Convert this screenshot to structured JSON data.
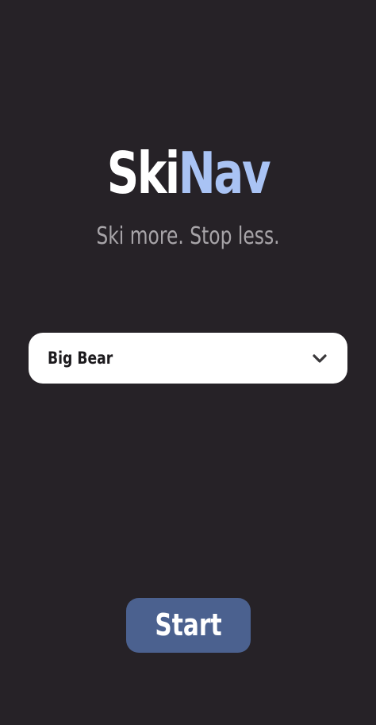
{
  "app": {
    "logo_part_a": "Ski",
    "logo_part_b": "Nav",
    "tagline": "Ski more. Stop less."
  },
  "resort_select": {
    "selected_value": "Big Bear",
    "icon": "chevron-down-icon"
  },
  "start_button": {
    "label": "Start"
  },
  "colors": {
    "background": "#262227",
    "logo_primary": "#ffffff",
    "logo_accent": "#a9c3f4",
    "tagline": "#a7a4a8",
    "button": "#4b618f"
  }
}
